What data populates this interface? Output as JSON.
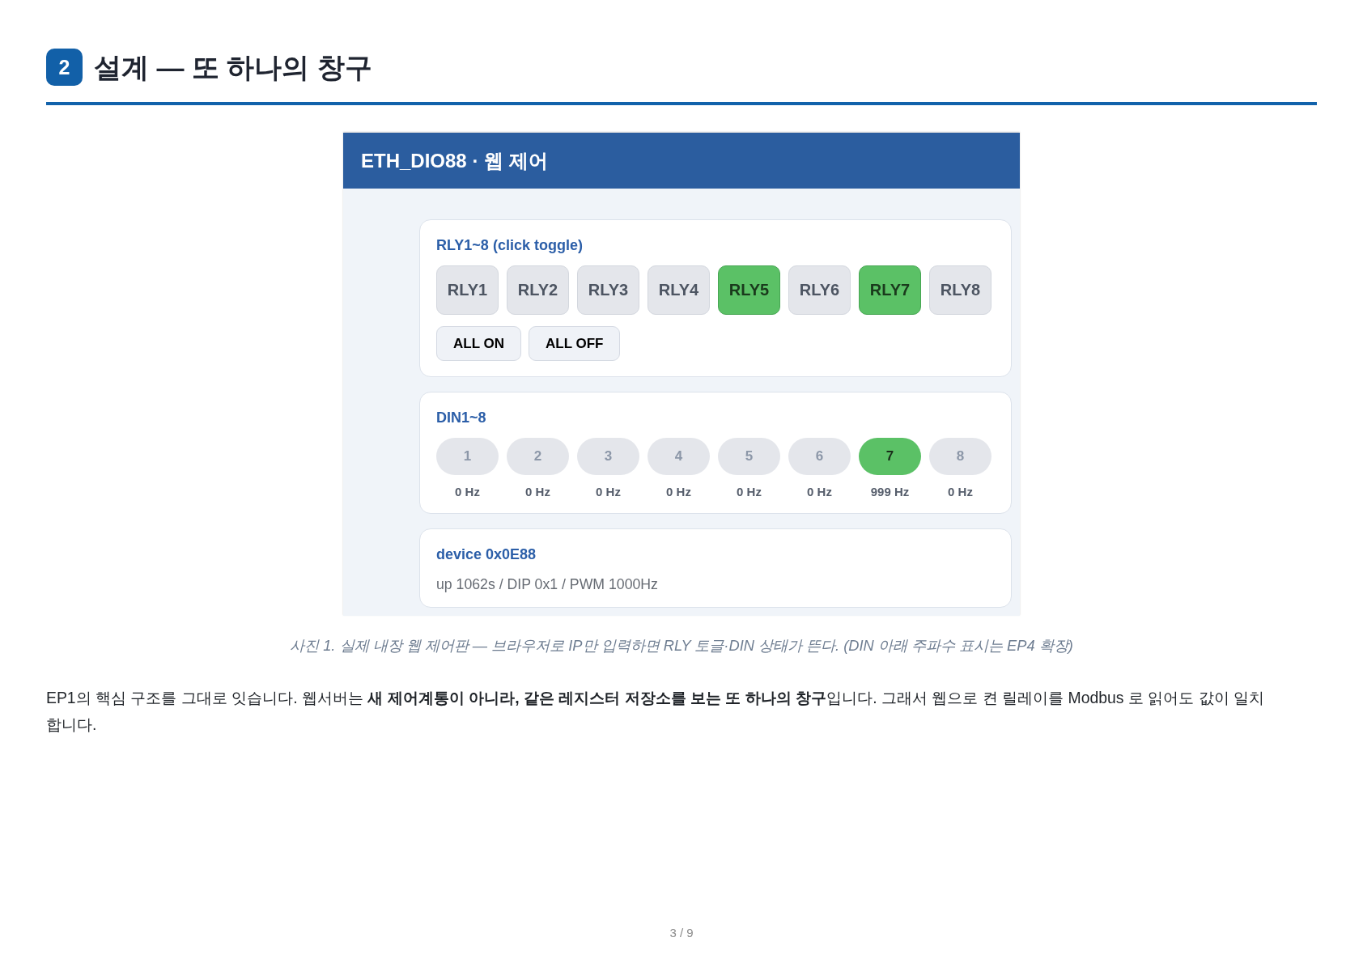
{
  "section": {
    "number": "2",
    "title": "설계 — 또 하나의 창구"
  },
  "figure": {
    "window": {
      "title": "ETH_DIO88 · 웹 제어"
    },
    "relay_card": {
      "label": "RLY1~8 (click toggle)",
      "relays": [
        {
          "label": "RLY1",
          "on": false
        },
        {
          "label": "RLY2",
          "on": false
        },
        {
          "label": "RLY3",
          "on": false
        },
        {
          "label": "RLY4",
          "on": false
        },
        {
          "label": "RLY5",
          "on": true
        },
        {
          "label": "RLY6",
          "on": false
        },
        {
          "label": "RLY7",
          "on": true
        },
        {
          "label": "RLY8",
          "on": false
        }
      ],
      "buttons": [
        "ALL ON",
        "ALL OFF"
      ]
    },
    "input_card": {
      "label": "DIN1~8",
      "inputs": [
        {
          "label": "1",
          "on": false,
          "frequency": "0 Hz"
        },
        {
          "label": "2",
          "on": false,
          "frequency": "0 Hz"
        },
        {
          "label": "3",
          "on": false,
          "frequency": "0 Hz"
        },
        {
          "label": "4",
          "on": false,
          "frequency": "0 Hz"
        },
        {
          "label": "5",
          "on": false,
          "frequency": "0 Hz"
        },
        {
          "label": "6",
          "on": false,
          "frequency": "0 Hz"
        },
        {
          "label": "7",
          "on": true,
          "frequency": "999 Hz"
        },
        {
          "label": "8",
          "on": false,
          "frequency": "0 Hz"
        }
      ]
    },
    "device_card": {
      "title": "device 0x0E88",
      "status": "up 1062s / DIP 0x1 / PWM 1000Hz"
    },
    "caption": "사진 1. 실제 내장 웹 제어판 — 브라우저로 IP만 입력하면 RLY 토글·DIN 상태가 뜬다. (DIN 아래 주파수 표시는 EP4 확장)"
  },
  "paragraph": "EP1의 핵심 구조를 그대로 잇습니다. 웹서버는 **새 제어계통이 아니라, 같은 레지스터 저장소를 보는 또 하나의 창구**입니다. 그래서 웹으로 켠 릴레이를 Modbus 로 읽어도 값이 일치합니다.",
  "page_number": "3 / 9"
}
